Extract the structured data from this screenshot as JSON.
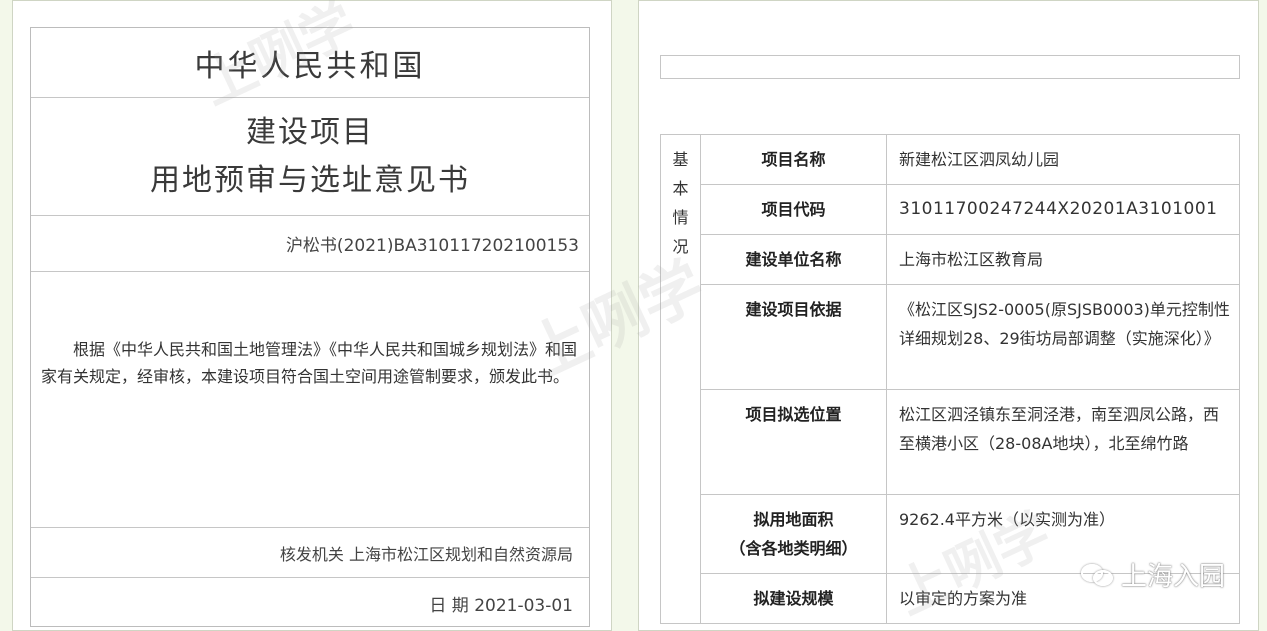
{
  "left": {
    "country": "中华人民共和国",
    "title_line1": "建设项目",
    "title_line2": "用地预审与选址意见书",
    "doc_number": "沪松书(2021)BA310117202100153",
    "body_text": "根据《中华人民共和国土地管理法》《中华人民共和国城乡规划法》和国家有关规定，经审核，本建设项目符合国土空间用途管制要求，颁发此书。",
    "issuer": "核发机关 上海市松江区规划和自然资源局",
    "date": "日  期 2021-03-01"
  },
  "right": {
    "category": "基本情况",
    "rows": [
      {
        "label": "项目名称",
        "value": "新建松江区泗凤幼儿园"
      },
      {
        "label": "项目代码",
        "value": "31011700247244X20201A3101001"
      },
      {
        "label": "建设单位名称",
        "value": "上海市松江区教育局"
      },
      {
        "label": "建设项目依据",
        "value": "《松江区SJS2-0005(原SJSB0003)单元控制性详细规划28、29街坊局部调整（实施深化）》"
      },
      {
        "label": "项目拟选位置",
        "value": "松江区泗泾镇东至洞泾港，南至泗凤公路，西至横港小区（28-08A地块），北至绵竹路"
      },
      {
        "label": "拟用地面积（含各地类明细）",
        "label_line1": "拟用地面积",
        "label_line2": "（含各地类明细）",
        "value": "9262.4平方米（以实测为准）"
      },
      {
        "label": "拟建设规模",
        "value": "以审定的方案为准"
      }
    ]
  },
  "watermark": {
    "text": "上咧学"
  },
  "wechat_badge": {
    "text": "上海入园",
    "icon": "wechat-icon"
  }
}
